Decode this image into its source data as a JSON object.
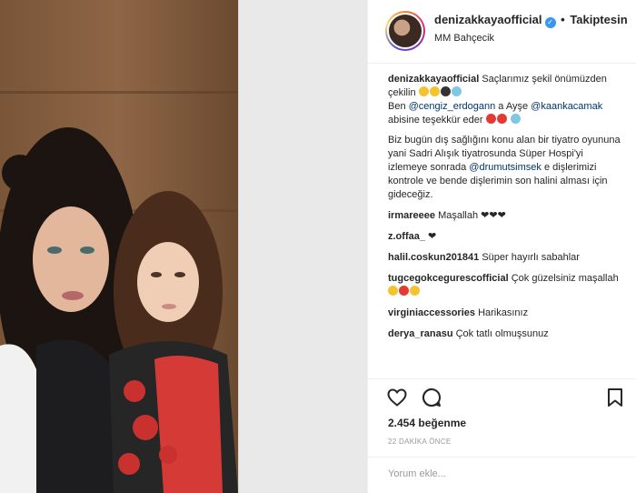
{
  "post": {
    "username": "denizakkayaofficial",
    "verified_badge": "✓",
    "separator": "•",
    "follow_label": "Takiptesin",
    "location": "MM Bahçecik"
  },
  "caption": {
    "username": "denizakkayaofficial",
    "text1": "Saçlarımız şekil önümüzden çekilin",
    "line2_prefix": "Ben",
    "mention1": "@cengiz_erdogann",
    "line2_mid": "a Ayşe",
    "mention2": "@kaankacamak",
    "line2_suffix": "abisine teşekkür eder",
    "para2": "Biz bugün dış sağlığını konu alan bir tiyatro oyununa yani Sadri Alışık tiyatrosunda Süper Hospi'yi izlemeye sonrada",
    "mention3": "@drumutsimsek",
    "para2_suffix": "e dişlerimizi kontrole ve bende dişlerimin son halini alması için gideceğiz."
  },
  "comments": [
    {
      "user": "irmareeee",
      "text": "Maşallah ❤❤❤"
    },
    {
      "user": "z.offaa_",
      "text": "❤"
    },
    {
      "user": "halil.coskun201841",
      "text": "Süper hayırlı sabahlar"
    },
    {
      "user": "tugcegokcegurescofficial",
      "text": "Çok güzelsiniz maşallah"
    },
    {
      "user": "virginiaccessories",
      "text": "Harikasınız"
    },
    {
      "user": "derya_ranasu",
      "text": "Çok tatlı olmuşsunuz"
    }
  ],
  "stats": {
    "likes": "2.454 beğenme",
    "time": "22 DAKİKA ÖNCE"
  },
  "input": {
    "placeholder": "Yorum ekle..."
  },
  "icons": {
    "like": "heart-icon",
    "comment": "comment-bubble-icon",
    "save": "bookmark-icon",
    "verified": "verified-badge-icon"
  },
  "colors": {
    "mention": "#003569",
    "verified": "#3897f0",
    "muted": "#999999"
  }
}
